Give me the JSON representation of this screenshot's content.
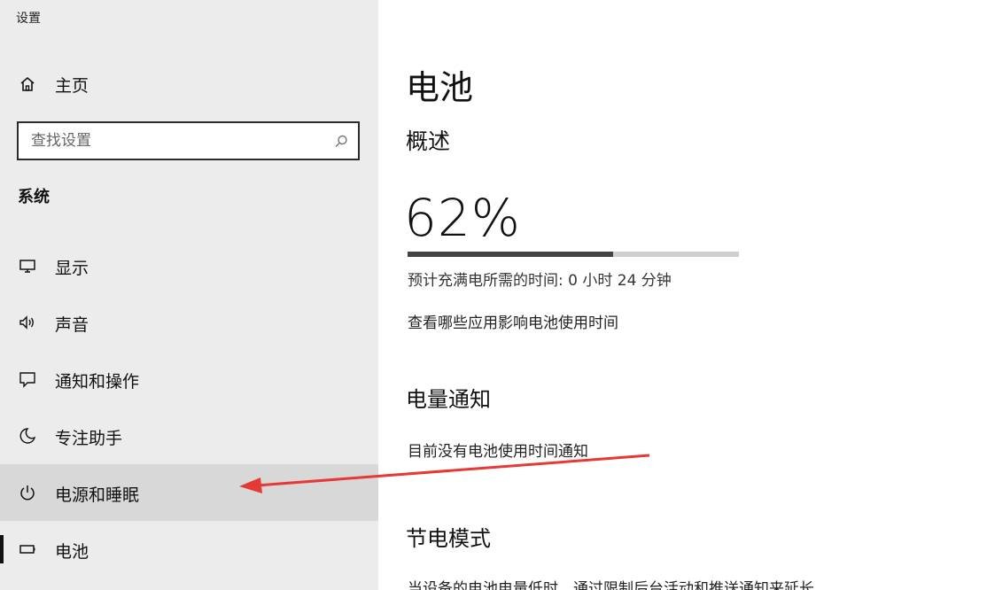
{
  "window": {
    "title": "设置"
  },
  "sidebar": {
    "home_label": "主页",
    "search": {
      "placeholder": "查找设置"
    },
    "section_header": "系统",
    "items": [
      {
        "label": "显示",
        "icon": "display-icon"
      },
      {
        "label": "声音",
        "icon": "speaker-icon"
      },
      {
        "label": "通知和操作",
        "icon": "notification-icon"
      },
      {
        "label": "专注助手",
        "icon": "moon-icon"
      },
      {
        "label": "电源和睡眠",
        "icon": "power-icon",
        "selected": true
      },
      {
        "label": "电池",
        "icon": "battery-icon"
      }
    ]
  },
  "main": {
    "title": "电池",
    "overview_title": "概述",
    "battery_percent_text": "62%",
    "battery_level": 0.62,
    "estimate_text": "预计充满电所需的时间: 0 小时 24 分钟",
    "usage_link": "查看哪些应用影响电池使用时间",
    "notify_title": "电量通知",
    "notify_text": "目前没有电池使用时间通知",
    "saver_title": "节电模式",
    "saver_desc": "当设备的电池电量低时，通过限制后台活动和推送通知来延长"
  },
  "colors": {
    "annotation_arrow": "#e53935"
  }
}
